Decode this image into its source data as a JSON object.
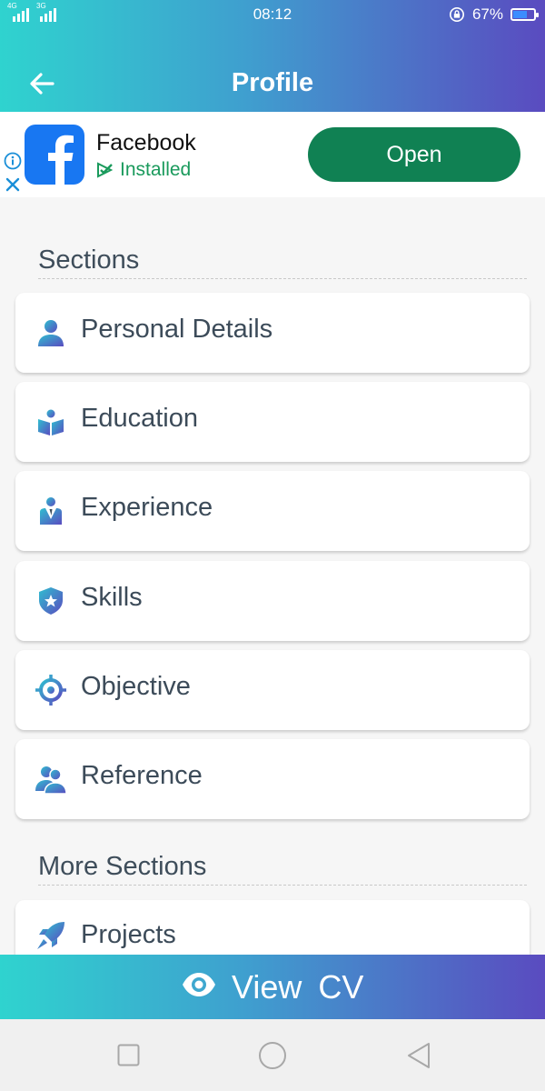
{
  "status_bar": {
    "network_1": "4G",
    "network_2": "3G",
    "time": "08:12",
    "battery": "67%",
    "battery_level": 0.67
  },
  "toolbar": {
    "back_icon": "arrow-left-icon",
    "title": "Profile"
  },
  "ad": {
    "app_name": "Facebook",
    "status": "Installed",
    "button": "Open"
  },
  "sections": {
    "title": "Sections",
    "items": [
      {
        "label": "Personal Details",
        "icon": "person-icon"
      },
      {
        "label": "Education",
        "icon": "book-reader-icon"
      },
      {
        "label": "Experience",
        "icon": "business-person-icon"
      },
      {
        "label": "Skills",
        "icon": "shield-star-icon"
      },
      {
        "label": "Objective",
        "icon": "target-icon"
      },
      {
        "label": "Reference",
        "icon": "people-icon"
      }
    ]
  },
  "more_sections": {
    "title": "More Sections",
    "items": [
      {
        "label": "Projects",
        "icon": "rocket-icon"
      }
    ]
  },
  "bottom_button": {
    "label": "View CV",
    "icon": "eye-icon"
  },
  "colors": {
    "gradient_start": "#2fd3cf",
    "gradient_end": "#5a4bc0",
    "open_button": "#108153",
    "installed_text": "#1a9a5c"
  }
}
